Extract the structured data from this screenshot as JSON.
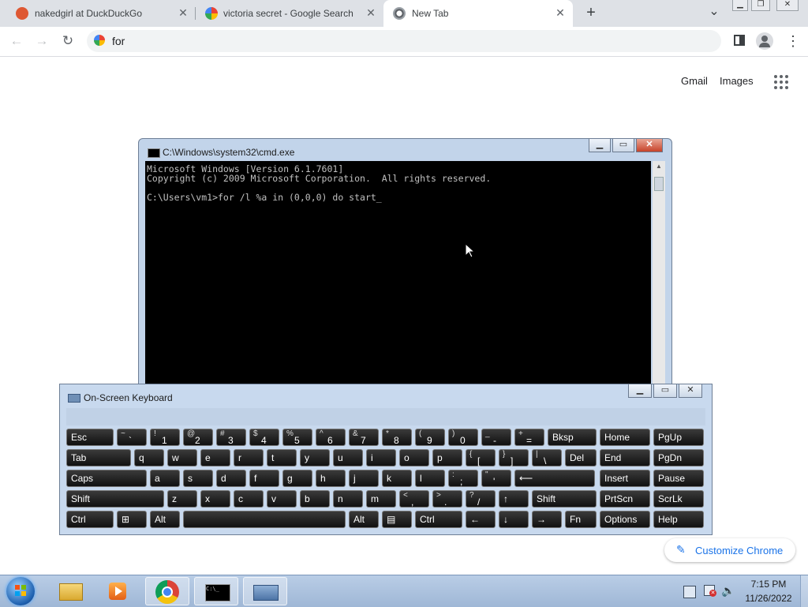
{
  "browser": {
    "tabs": [
      {
        "title": "nakedgirl at DuckDuckGo",
        "icon": "duckduckgo-icon"
      },
      {
        "title": "victoria secret - Google Search",
        "icon": "google-icon"
      },
      {
        "title": "New Tab",
        "icon": "chrome-icon"
      }
    ],
    "new_tab_symbol": "+",
    "tab_search_symbol": "⌄",
    "omnibox_value": "for",
    "ntp_links": {
      "gmail": "Gmail",
      "images": "Images"
    },
    "customize_label": "Customize Chrome"
  },
  "cmd": {
    "title": "C:\\Windows\\system32\\cmd.exe",
    "lines": [
      "Microsoft Windows [Version 6.1.7601]",
      "Copyright (c) 2009 Microsoft Corporation.  All rights reserved.",
      "",
      "C:\\Users\\vm1>for /l %a in (0,0,0) do start_"
    ]
  },
  "osk": {
    "title": "On-Screen Keyboard",
    "rows": [
      [
        {
          "label": "Esc",
          "w": 60
        },
        {
          "top": "~",
          "bottom": "`",
          "w": 38
        },
        {
          "top": "!",
          "bottom": "1",
          "w": 38
        },
        {
          "top": "@",
          "bottom": "2",
          "w": 38
        },
        {
          "top": "#",
          "bottom": "3",
          "w": 38
        },
        {
          "top": "$",
          "bottom": "4",
          "w": 38
        },
        {
          "top": "%",
          "bottom": "5",
          "w": 38
        },
        {
          "top": "^",
          "bottom": "6",
          "w": 38
        },
        {
          "top": "&",
          "bottom": "7",
          "w": 38
        },
        {
          "top": "*",
          "bottom": "8",
          "w": 38
        },
        {
          "top": "(",
          "bottom": "9",
          "w": 38
        },
        {
          "top": ")",
          "bottom": "0",
          "w": 38
        },
        {
          "top": "_",
          "bottom": "-",
          "w": 38
        },
        {
          "top": "+",
          "bottom": "=",
          "w": 38
        },
        {
          "label": "Bksp",
          "w": 62
        }
      ],
      [
        {
          "label": "Tab",
          "w": 82
        },
        {
          "label": "q",
          "w": 38
        },
        {
          "label": "w",
          "w": 38
        },
        {
          "label": "e",
          "w": 38
        },
        {
          "label": "r",
          "w": 38
        },
        {
          "label": "t",
          "w": 38
        },
        {
          "label": "y",
          "w": 38
        },
        {
          "label": "u",
          "w": 38
        },
        {
          "label": "i",
          "w": 38
        },
        {
          "label": "o",
          "w": 38
        },
        {
          "label": "p",
          "w": 38
        },
        {
          "top": "{",
          "bottom": "[",
          "w": 38
        },
        {
          "top": "}",
          "bottom": "]",
          "w": 38
        },
        {
          "top": "|",
          "bottom": "\\",
          "w": 38
        },
        {
          "label": "Del",
          "w": 40
        }
      ],
      [
        {
          "label": "Caps",
          "w": 102
        },
        {
          "label": "a",
          "w": 38
        },
        {
          "label": "s",
          "w": 38
        },
        {
          "label": "d",
          "w": 38
        },
        {
          "label": "f",
          "w": 38
        },
        {
          "label": "g",
          "w": 38
        },
        {
          "label": "h",
          "w": 38
        },
        {
          "label": "j",
          "w": 38
        },
        {
          "label": "k",
          "w": 38
        },
        {
          "label": "l",
          "w": 38
        },
        {
          "top": ":",
          "bottom": ";",
          "w": 38
        },
        {
          "top": "\"",
          "bottom": "'",
          "w": 38
        },
        {
          "label": "⟵",
          "w": 102
        }
      ],
      [
        {
          "label": "Shift",
          "w": 124
        },
        {
          "label": "z",
          "w": 38
        },
        {
          "label": "x",
          "w": 38
        },
        {
          "label": "c",
          "w": 38
        },
        {
          "label": "v",
          "w": 38
        },
        {
          "label": "b",
          "w": 38
        },
        {
          "label": "n",
          "w": 38
        },
        {
          "label": "m",
          "w": 38
        },
        {
          "top": "<",
          "bottom": ",",
          "w": 38
        },
        {
          "top": ">",
          "bottom": ".",
          "w": 38
        },
        {
          "top": "?",
          "bottom": "/",
          "w": 38
        },
        {
          "label": "↑",
          "w": 38
        },
        {
          "label": "Shift",
          "w": 82
        }
      ],
      [
        {
          "label": "Ctrl",
          "w": 60
        },
        {
          "label": "⊞",
          "w": 38
        },
        {
          "label": "Alt",
          "w": 38
        },
        {
          "label": "",
          "w": 206
        },
        {
          "label": "Alt",
          "w": 38
        },
        {
          "label": "▤",
          "w": 38
        },
        {
          "label": "Ctrl",
          "w": 60
        },
        {
          "label": "←",
          "w": 38
        },
        {
          "label": "↓",
          "w": 38
        },
        {
          "label": "→",
          "w": 38
        },
        {
          "label": "Fn",
          "w": 40
        }
      ]
    ],
    "side_keys": [
      [
        "Home",
        "PgUp"
      ],
      [
        "End",
        "PgDn"
      ],
      [
        "Insert",
        "Pause"
      ],
      [
        "PrtScn",
        "ScrLk"
      ],
      [
        "Options",
        "Help"
      ]
    ]
  },
  "taskbar": {
    "items": [
      "start-orb",
      "explorer-icon",
      "media-player-icon",
      "chrome-icon",
      "cmd-icon",
      "osk-icon"
    ],
    "time": "7:15 PM",
    "date": "11/26/2022"
  }
}
